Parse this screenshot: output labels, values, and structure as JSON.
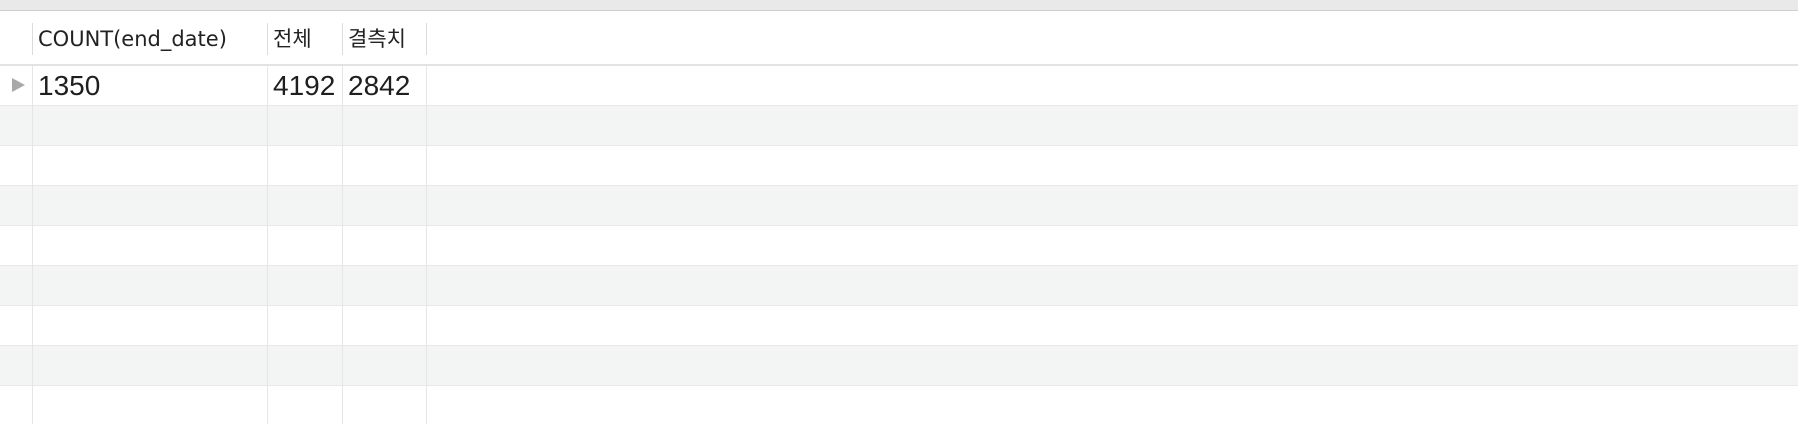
{
  "columns": [
    {
      "label": "COUNT(end_date)"
    },
    {
      "label": "전체"
    },
    {
      "label": "결측치"
    }
  ],
  "rows": [
    {
      "values": [
        "1350",
        "4192",
        "2842"
      ],
      "selected": true
    }
  ],
  "indicator_icon": "triangle-right-icon",
  "colors": {
    "stripe": "#f3f4f4",
    "grid_line": "#e6e6e6",
    "indicator": "#a9a9a9"
  }
}
